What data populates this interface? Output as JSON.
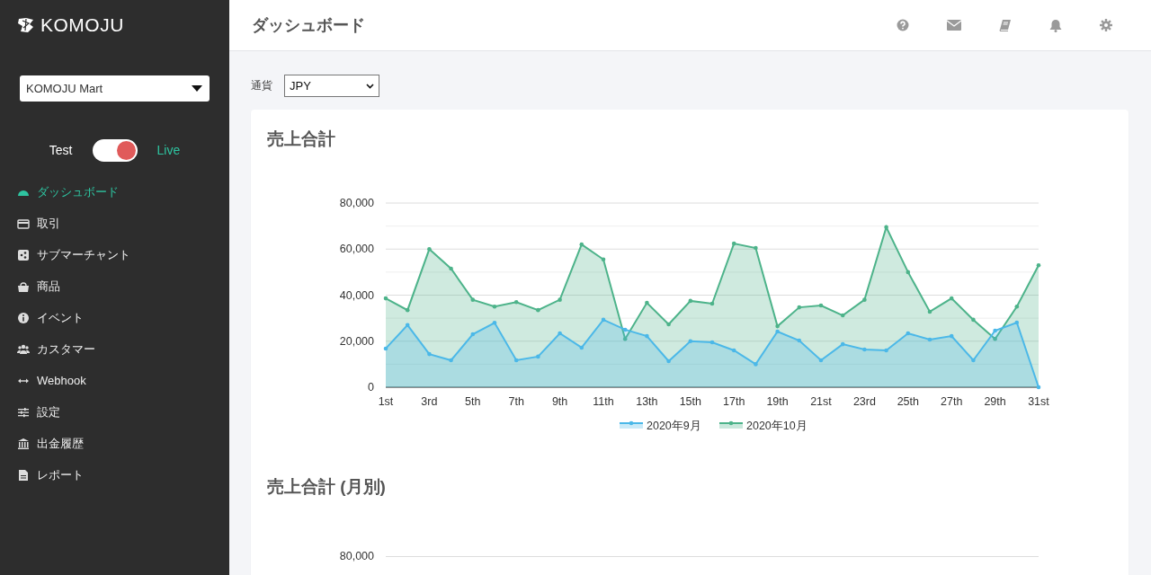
{
  "sidebar": {
    "logo": "KOMOJU",
    "store_select": {
      "value": "KOMOJU Mart"
    },
    "mode_toggle": {
      "test_label": "Test",
      "live_label": "Live",
      "live": true
    },
    "items": [
      {
        "label": "ダッシュボード",
        "selected": true
      },
      {
        "label": "取引",
        "selected": false
      },
      {
        "label": "サブマーチャント",
        "selected": false
      },
      {
        "label": "商品",
        "selected": false
      },
      {
        "label": "イベント",
        "selected": false
      },
      {
        "label": "カスタマー",
        "selected": false
      },
      {
        "label": "Webhook",
        "selected": false
      },
      {
        "label": "設定",
        "selected": false
      },
      {
        "label": "出金履歴",
        "selected": false
      },
      {
        "label": "レポート",
        "selected": false
      }
    ]
  },
  "header": {
    "title": "ダッシュボード"
  },
  "currency": {
    "label": "通貨",
    "value": "JPY"
  },
  "cards": [
    {
      "title": "売上合計",
      "chart_data": {
        "type": "area",
        "x": [
          1,
          2,
          3,
          4,
          5,
          6,
          7,
          8,
          9,
          10,
          11,
          12,
          13,
          14,
          15,
          16,
          17,
          18,
          19,
          20,
          21,
          22,
          23,
          24,
          25,
          26,
          27,
          28,
          29,
          30,
          31
        ],
        "xticks": [
          {
            "value": 1,
            "label": "1st"
          },
          {
            "value": 3,
            "label": "3rd"
          },
          {
            "value": 5,
            "label": "5th"
          },
          {
            "value": 7,
            "label": "7th"
          },
          {
            "value": 9,
            "label": "9th"
          },
          {
            "value": 11,
            "label": "11th"
          },
          {
            "value": 13,
            "label": "13th"
          },
          {
            "value": 15,
            "label": "15th"
          },
          {
            "value": 17,
            "label": "17th"
          },
          {
            "value": 19,
            "label": "19th"
          },
          {
            "value": 21,
            "label": "21st"
          },
          {
            "value": 23,
            "label": "23rd"
          },
          {
            "value": 25,
            "label": "25th"
          },
          {
            "value": 27,
            "label": "27th"
          },
          {
            "value": 29,
            "label": "29th"
          },
          {
            "value": 31,
            "label": "31st"
          }
        ],
        "xlim": [
          1,
          31
        ],
        "ylim": [
          0,
          80000
        ],
        "grid": true,
        "legend": true,
        "yticks": [
          {
            "value": 0,
            "label": "0"
          },
          {
            "value": 20000,
            "label": "20,000"
          },
          {
            "value": 40000,
            "label": "40,000"
          },
          {
            "value": 60000,
            "label": "60,000"
          },
          {
            "value": 80000,
            "label": "80,000"
          }
        ],
        "series": [
          {
            "name": "2020年9月",
            "color": "#4bb8e8",
            "values": [
              16800,
              27000,
              14400,
              11700,
              23000,
              28000,
              11700,
              13300,
              23400,
              17200,
              29300,
              25000,
              22200,
              11300,
              20000,
              19500,
              16000,
              10000,
              24200,
              20300,
              11700,
              18700,
              16400,
              16000,
              23400,
              20700,
              22200,
              11700,
              24600,
              28100,
              0
            ]
          },
          {
            "name": "2020年10月",
            "color": "#4db38a",
            "values": [
              38600,
              33500,
              60000,
              51500,
              38000,
              35000,
              37000,
              33500,
              38000,
              62000,
              55500,
              21000,
              36700,
              27300,
              37500,
              36300,
              62400,
              60500,
              26500,
              34700,
              35500,
              31200,
              38000,
              69500,
              50000,
              32800,
              38600,
              29300,
              21000,
              35000,
              53000
            ]
          }
        ]
      }
    },
    {
      "title": "売上合計 (月別)",
      "axis_tick": "80,000"
    }
  ]
}
